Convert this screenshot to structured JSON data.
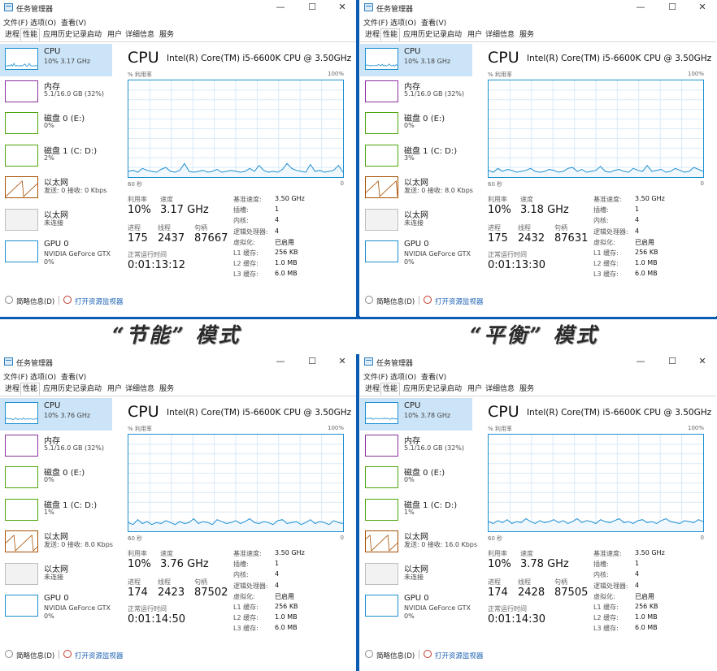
{
  "captions": [
    "“节能”  模式",
    "“平衡”  模式"
  ],
  "windows": [
    {
      "title": "任务管理器",
      "menu": [
        "文件(F)",
        "选项(O)",
        "查看(V)"
      ],
      "tabs": [
        "进程",
        "性能",
        "应用历史记录",
        "启动",
        "用户",
        "详细信息",
        "服务"
      ],
      "active_tab": "性能",
      "sidebar": [
        {
          "name": "CPU",
          "detail": "10% 3.17 GHz"
        },
        {
          "name": "内存",
          "detail": "5.1/16.0 GB (32%)"
        },
        {
          "name": "磁盘 0 (E:)",
          "detail": "0%"
        },
        {
          "name": "磁盘 1 (C: D:)",
          "detail": "2%"
        },
        {
          "name": "以太网",
          "detail": "发送: 0 接收: 0 Kbps"
        },
        {
          "name": "以太网",
          "detail": "未连接"
        },
        {
          "name": "GPU 0",
          "detail": "NVIDIA GeForce GTX",
          "detail2": "0%"
        }
      ],
      "header": {
        "title": "CPU",
        "cpu_name": "Intel(R) Core(TM) i5-6600K CPU @ 3.50GHz"
      },
      "graph": {
        "ylabel": "% 利用率",
        "ymax_label": "100%",
        "x_left": "60 秒",
        "x_right": "0",
        "series": [
          6,
          7,
          5,
          9,
          7,
          6,
          5,
          8,
          10,
          6,
          5,
          7,
          14,
          6,
          5,
          6,
          7,
          5,
          6,
          8,
          5,
          6,
          7,
          6,
          5,
          6,
          9,
          6,
          12,
          7,
          5,
          6,
          5,
          8,
          14,
          9,
          7,
          6,
          5,
          13,
          6,
          7,
          5,
          6,
          7,
          12,
          5
        ]
      },
      "stats": {
        "util_label": "利用率",
        "util": "10%",
        "speed_label": "速度",
        "speed": "3.17 GHz",
        "proc_label": "进程",
        "proc": "175",
        "threads_label": "线程",
        "threads": "2437",
        "handles_label": "句柄",
        "handles": "87667",
        "uptime_label": "正常运行时间",
        "uptime": "0:01:13:12"
      },
      "specs": [
        {
          "k": "基准速度:",
          "v": "3.50 GHz"
        },
        {
          "k": "插槽:",
          "v": "1"
        },
        {
          "k": "内核:",
          "v": "4"
        },
        {
          "k": "逻辑处理器:",
          "v": "4"
        },
        {
          "k": "虚拟化:",
          "v": "已启用"
        },
        {
          "k": "L1 缓存:",
          "v": "256 KB"
        },
        {
          "k": "L2 缓存:",
          "v": "1.0 MB"
        },
        {
          "k": "L3 缓存:",
          "v": "6.0 MB"
        }
      ],
      "footer": {
        "brief": "简略信息(D)",
        "monitor": "打开资源监视器"
      }
    },
    {
      "title": "任务管理器",
      "menu": [
        "文件(F)",
        "选项(O)",
        "查看(V)"
      ],
      "tabs": [
        "进程",
        "性能",
        "应用历史记录",
        "启动",
        "用户",
        "详细信息",
        "服务"
      ],
      "active_tab": "性能",
      "sidebar": [
        {
          "name": "CPU",
          "detail": "10% 3.18 GHz"
        },
        {
          "name": "内存",
          "detail": "5.1/16.0 GB (32%)"
        },
        {
          "name": "磁盘 0 (E:)",
          "detail": "0%"
        },
        {
          "name": "磁盘 1 (C: D:)",
          "detail": "3%"
        },
        {
          "name": "以太网",
          "detail": "发送: 0 接收: 8.0 Kbps"
        },
        {
          "name": "以太网",
          "detail": "未连接"
        },
        {
          "name": "GPU 0",
          "detail": "NVIDIA GeForce GTX",
          "detail2": "0%"
        }
      ],
      "header": {
        "title": "CPU",
        "cpu_name": "Intel(R) Core(TM) i5-6600K CPU @ 3.50GHz"
      },
      "graph": {
        "ylabel": "% 利用率",
        "ymax_label": "100%",
        "x_left": "60 秒",
        "x_right": "0",
        "series": [
          7,
          5,
          9,
          6,
          8,
          7,
          5,
          6,
          7,
          9,
          6,
          5,
          6,
          8,
          7,
          5,
          6,
          9,
          10,
          6,
          8,
          5,
          6,
          7,
          11,
          6,
          5,
          7,
          8,
          6,
          5,
          9,
          7,
          6,
          12,
          6,
          7,
          8,
          5,
          6,
          9,
          7,
          5,
          6,
          10,
          8,
          6
        ]
      },
      "stats": {
        "util_label": "利用率",
        "util": "10%",
        "speed_label": "速度",
        "speed": "3.18 GHz",
        "proc_label": "进程",
        "proc": "175",
        "threads_label": "线程",
        "threads": "2432",
        "handles_label": "句柄",
        "handles": "87631",
        "uptime_label": "正常运行时间",
        "uptime": "0:01:13:30"
      },
      "specs": [
        {
          "k": "基准速度:",
          "v": "3.50 GHz"
        },
        {
          "k": "插槽:",
          "v": "1"
        },
        {
          "k": "内核:",
          "v": "4"
        },
        {
          "k": "逻辑处理器:",
          "v": "4"
        },
        {
          "k": "虚拟化:",
          "v": "已启用"
        },
        {
          "k": "L1 缓存:",
          "v": "256 KB"
        },
        {
          "k": "L2 缓存:",
          "v": "1.0 MB"
        },
        {
          "k": "L3 缓存:",
          "v": "6.0 MB"
        }
      ],
      "footer": {
        "brief": "简略信息(D)",
        "monitor": "打开资源监视器"
      }
    },
    {
      "title": "任务管理器",
      "menu": [
        "文件(F)",
        "选项(O)",
        "查看(V)"
      ],
      "tabs": [
        "进程",
        "性能",
        "应用历史记录",
        "启动",
        "用户",
        "详细信息",
        "服务"
      ],
      "active_tab": "性能",
      "sidebar": [
        {
          "name": "CPU",
          "detail": "10% 3.76 GHz"
        },
        {
          "name": "内存",
          "detail": "5.1/16.0 GB (32%)"
        },
        {
          "name": "磁盘 0 (E:)",
          "detail": "0%"
        },
        {
          "name": "磁盘 1 (C: D:)",
          "detail": "1%"
        },
        {
          "name": "以太网",
          "detail": "发送: 0 接收: 8.0 Kbps"
        },
        {
          "name": "以太网",
          "detail": "未连接"
        },
        {
          "name": "GPU 0",
          "detail": "NVIDIA GeForce GTX",
          "detail2": "0%"
        }
      ],
      "header": {
        "title": "CPU",
        "cpu_name": "Intel(R) Core(TM) i5-6600K CPU @ 3.50GHz"
      },
      "graph": {
        "ylabel": "% 利用率",
        "ymax_label": "100%",
        "x_left": "60 秒",
        "x_right": "0",
        "series": [
          9,
          7,
          12,
          8,
          10,
          7,
          9,
          8,
          11,
          9,
          7,
          10,
          8,
          9,
          13,
          8,
          10,
          9,
          7,
          12,
          10,
          8,
          9,
          11,
          8,
          10,
          13,
          9,
          8,
          10,
          9,
          7,
          11,
          12,
          8,
          9,
          10,
          7,
          9,
          12,
          8,
          10,
          9,
          7,
          11,
          9,
          8
        ]
      },
      "stats": {
        "util_label": "利用率",
        "util": "10%",
        "speed_label": "速度",
        "speed": "3.76 GHz",
        "proc_label": "进程",
        "proc": "174",
        "threads_label": "线程",
        "threads": "2423",
        "handles_label": "句柄",
        "handles": "87502",
        "uptime_label": "正常运行时间",
        "uptime": "0:01:14:50"
      },
      "specs": [
        {
          "k": "基准速度:",
          "v": "3.50 GHz"
        },
        {
          "k": "插槽:",
          "v": "1"
        },
        {
          "k": "内核:",
          "v": "4"
        },
        {
          "k": "逻辑处理器:",
          "v": "4"
        },
        {
          "k": "虚拟化:",
          "v": "已启用"
        },
        {
          "k": "L1 缓存:",
          "v": "256 KB"
        },
        {
          "k": "L2 缓存:",
          "v": "1.0 MB"
        },
        {
          "k": "L3 缓存:",
          "v": "6.0 MB"
        }
      ],
      "footer": {
        "brief": "简略信息(D)",
        "monitor": "打开资源监视器"
      }
    },
    {
      "title": "任务管理器",
      "menu": [
        "文件(F)",
        "选项(O)",
        "查看(V)"
      ],
      "tabs": [
        "进程",
        "性能",
        "应用历史记录",
        "启动",
        "用户",
        "详细信息",
        "服务"
      ],
      "active_tab": "性能",
      "sidebar": [
        {
          "name": "CPU",
          "detail": "10% 3.78 GHz"
        },
        {
          "name": "内存",
          "detail": "5.1/16.0 GB (32%)"
        },
        {
          "name": "磁盘 0 (E:)",
          "detail": "0%"
        },
        {
          "name": "磁盘 1 (C: D:)",
          "detail": "1%"
        },
        {
          "name": "以太网",
          "detail": "发送: 0 接收: 16.0 Kbps"
        },
        {
          "name": "以太网",
          "detail": "未连接"
        },
        {
          "name": "GPU 0",
          "detail": "NVIDIA GeForce GTX",
          "detail2": "0%"
        }
      ],
      "header": {
        "title": "CPU",
        "cpu_name": "Intel(R) Core(TM) i5-6600K CPU @ 3.50GHz"
      },
      "graph": {
        "ylabel": "% 利用率",
        "ymax_label": "100%",
        "x_left": "60 秒",
        "x_right": "0",
        "series": [
          10,
          8,
          11,
          9,
          12,
          8,
          10,
          9,
          13,
          10,
          8,
          11,
          9,
          10,
          12,
          9,
          11,
          8,
          10,
          13,
          9,
          11,
          10,
          8,
          12,
          10,
          9,
          11,
          13,
          9,
          10,
          8,
          11,
          12,
          9,
          10,
          8,
          11,
          13,
          10,
          9,
          8,
          11,
          10,
          9,
          12,
          10
        ]
      },
      "stats": {
        "util_label": "利用率",
        "util": "10%",
        "speed_label": "速度",
        "speed": "3.78 GHz",
        "proc_label": "进程",
        "proc": "174",
        "threads_label": "线程",
        "threads": "2428",
        "handles_label": "句柄",
        "handles": "87505",
        "uptime_label": "正常运行时间",
        "uptime": "0:01:14:30"
      },
      "specs": [
        {
          "k": "基准速度:",
          "v": "3.50 GHz"
        },
        {
          "k": "插槽:",
          "v": "1"
        },
        {
          "k": "内核:",
          "v": "4"
        },
        {
          "k": "逻辑处理器:",
          "v": "4"
        },
        {
          "k": "虚拟化:",
          "v": "已启用"
        },
        {
          "k": "L1 缓存:",
          "v": "256 KB"
        },
        {
          "k": "L2 缓存:",
          "v": "1.0 MB"
        },
        {
          "k": "L3 缓存:",
          "v": "6.0 MB"
        }
      ],
      "footer": {
        "brief": "简略信息(D)",
        "monitor": "打开资源监视器"
      }
    }
  ],
  "colors": {
    "cpu": "#1c8fd1",
    "memory": "#8b2f9e",
    "disk": "#4da60c",
    "ethernet": "#a74f01",
    "gpu": "#1c8fd1",
    "selected": "#cce4f7",
    "link": "#1a5fb4",
    "divider": "#0b5bb3"
  },
  "icons": {
    "app": "task-manager-icon",
    "brief": "chevron-up-icon",
    "monitor": "resource-monitor-icon"
  }
}
